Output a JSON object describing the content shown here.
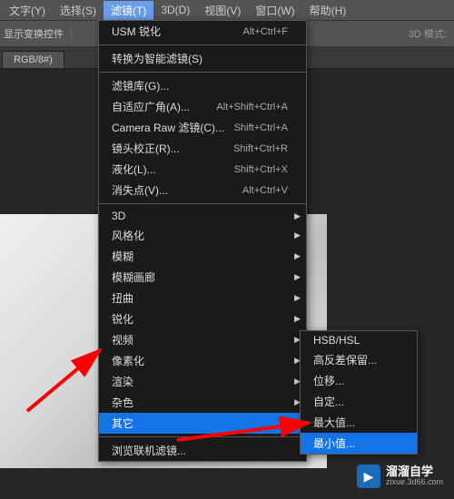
{
  "menubar": [
    "文字(Y)",
    "选择(S)",
    "滤镜(T)",
    "3D(D)",
    "视图(V)",
    "窗口(W)",
    "帮助(H)"
  ],
  "menubar_active_index": 2,
  "options": {
    "label": "显示变换控件",
    "mode": "3D 模式:"
  },
  "tab": {
    "label": "RGB/8#)"
  },
  "menu": {
    "top": [
      {
        "label": "USM 锐化",
        "shortcut": "Alt+Ctrl+F"
      }
    ],
    "group1": [
      {
        "label": "转换为智能滤镜(S)",
        "shortcut": ""
      }
    ],
    "group2": [
      {
        "label": "滤镜库(G)...",
        "shortcut": ""
      },
      {
        "label": "自适应广角(A)...",
        "shortcut": "Alt+Shift+Ctrl+A"
      },
      {
        "label": "Camera Raw 滤镜(C)...",
        "shortcut": "Shift+Ctrl+A"
      },
      {
        "label": "镜头校正(R)...",
        "shortcut": "Shift+Ctrl+R"
      },
      {
        "label": "液化(L)...",
        "shortcut": "Shift+Ctrl+X"
      },
      {
        "label": "消失点(V)...",
        "shortcut": "Alt+Ctrl+V"
      }
    ],
    "group3": [
      {
        "label": "3D",
        "sub": true
      },
      {
        "label": "风格化",
        "sub": true
      },
      {
        "label": "模糊",
        "sub": true
      },
      {
        "label": "模糊画廊",
        "sub": true
      },
      {
        "label": "扭曲",
        "sub": true
      },
      {
        "label": "锐化",
        "sub": true
      },
      {
        "label": "视频",
        "sub": true
      },
      {
        "label": "像素化",
        "sub": true
      },
      {
        "label": "渲染",
        "sub": true
      },
      {
        "label": "杂色",
        "sub": true
      },
      {
        "label": "其它",
        "sub": true,
        "highlight": true
      }
    ],
    "group4": [
      {
        "label": "浏览联机滤镜..."
      }
    ]
  },
  "submenu": [
    {
      "label": "HSB/HSL"
    },
    {
      "label": "高反差保留..."
    },
    {
      "label": "位移..."
    },
    {
      "label": "自定..."
    },
    {
      "label": "最大值..."
    },
    {
      "label": "最小值...",
      "highlight": true
    }
  ],
  "watermark": {
    "brand": "溜溜自学",
    "site": "zixue.3d66.com"
  }
}
